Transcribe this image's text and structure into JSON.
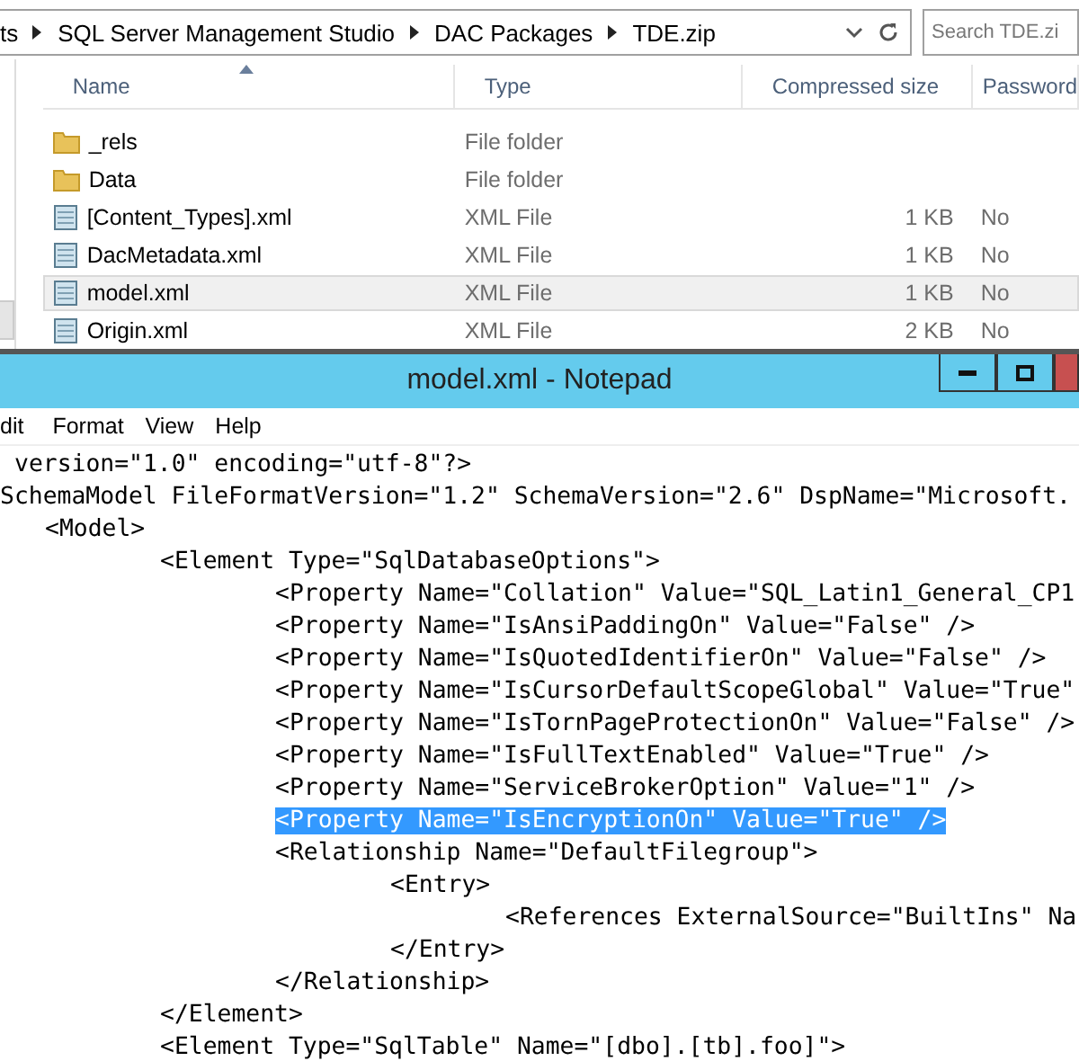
{
  "explorer": {
    "breadcrumb": [
      "ts",
      "SQL Server Management Studio",
      "DAC Packages",
      "TDE.zip"
    ],
    "search": {
      "placeholder": "Search TDE.zi"
    },
    "columns": [
      {
        "label": "Name",
        "sorted": true
      },
      {
        "label": "Type",
        "sorted": false
      },
      {
        "label": "Compressed size",
        "sorted": false
      },
      {
        "label": "Password",
        "sorted": false
      }
    ],
    "files": [
      {
        "kind": "folder",
        "name": "_rels",
        "type": "File folder",
        "selected": false
      },
      {
        "kind": "folder",
        "name": "Data",
        "type": "File folder",
        "selected": false
      },
      {
        "kind": "xml",
        "name": "[Content_Types].xml",
        "type": "XML File",
        "size": "1 KB",
        "password": "No",
        "selected": false
      },
      {
        "kind": "xml",
        "name": "DacMetadata.xml",
        "type": "XML File",
        "size": "1 KB",
        "password": "No",
        "selected": false
      },
      {
        "kind": "xml",
        "name": "model.xml",
        "type": "XML File",
        "size": "1 KB",
        "password": "No",
        "selected": true
      },
      {
        "kind": "xml",
        "name": "Origin.xml",
        "type": "XML File",
        "size": "2 KB",
        "password": "No",
        "selected": false
      }
    ]
  },
  "notepad": {
    "title": "model.xml - Notepad",
    "menu": [
      "dit",
      "Format",
      "View",
      "Help"
    ],
    "lines": [
      {
        "text": "version=\"1.0\" encoding=\"utf-8\"?>",
        "selected": false
      },
      {
        "text": "SchemaModel FileFormatVersion=\"1.2\" SchemaVersion=\"2.6\" DspName=\"Microsoft.",
        "selected": false,
        "children": [
          {
            "text": "<Model>",
            "selected": false,
            "children": [
              {
                "text": "<Element Type=\"SqlDatabaseOptions\">",
                "selected": false,
                "children": [
                  {
                    "text": "<Property Name=\"Collation\" Value=\"SQL_Latin1_General_CP1",
                    "selected": false
                  },
                  {
                    "text": "<Property Name=\"IsAnsiPaddingOn\" Value=\"False\" />",
                    "selected": false
                  },
                  {
                    "text": "<Property Name=\"IsQuotedIdentifierOn\" Value=\"False\" />",
                    "selected": false
                  },
                  {
                    "text": "<Property Name=\"IsCursorDefaultScopeGlobal\" Value=\"True\"",
                    "selected": false
                  },
                  {
                    "text": "<Property Name=\"IsTornPageProtectionOn\" Value=\"False\" />",
                    "selected": false
                  },
                  {
                    "text": "<Property Name=\"IsFullTextEnabled\" Value=\"True\" />",
                    "selected": false
                  },
                  {
                    "text": "<Property Name=\"ServiceBrokerOption\" Value=\"1\" />",
                    "selected": false
                  },
                  {
                    "text": "<Property Name=\"IsEncryptionOn\" Value=\"True\" />",
                    "selected": true
                  },
                  {
                    "text": "<Relationship Name=\"DefaultFilegroup\">",
                    "selected": false,
                    "children": [
                      {
                        "text": "<Entry>",
                        "selected": false,
                        "children": [
                          {
                            "text": "<References ExternalSource=\"BuiltIns\" Na",
                            "selected": false
                          }
                        ]
                      },
                      {
                        "text": "</Entry>",
                        "selected": false
                      }
                    ]
                  },
                  {
                    "text": "</Relationship>",
                    "selected": false
                  }
                ]
              },
              {
                "text": "</Element>",
                "selected": false
              },
              {
                "text": "<Element Type=\"SqlTable\" Name=\"[dbo].[tb].foo]\">",
                "selected": false
              }
            ]
          }
        ]
      }
    ]
  }
}
